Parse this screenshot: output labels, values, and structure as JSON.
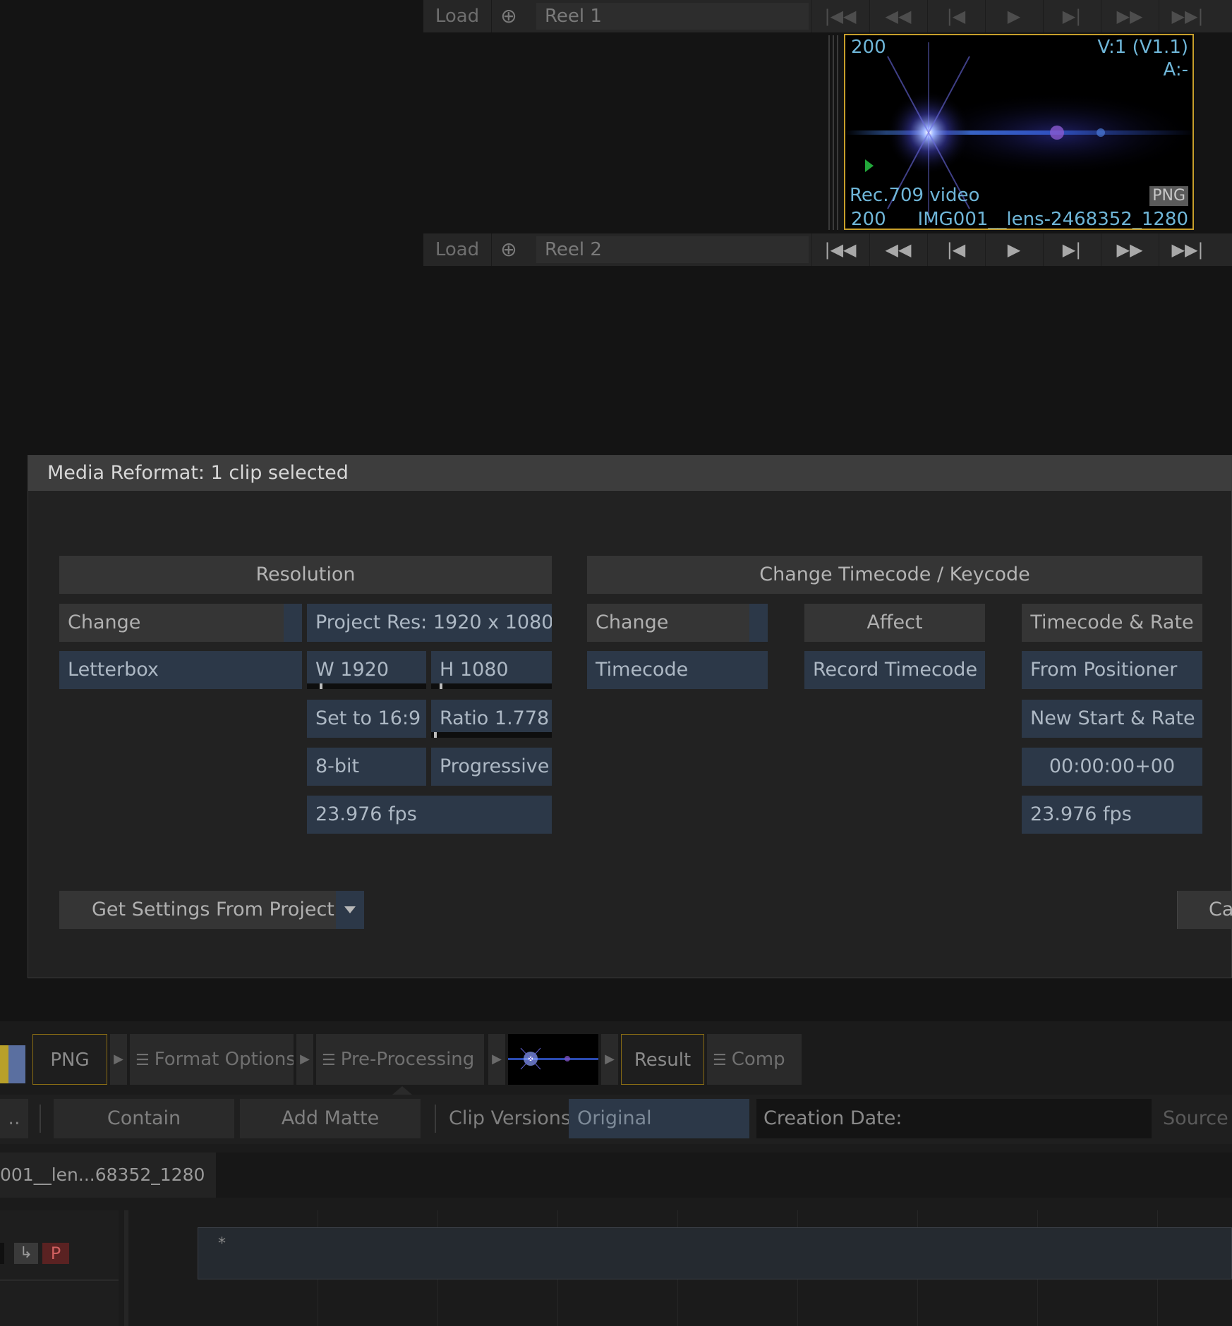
{
  "reel1": {
    "load_label": "Load",
    "name": "Reel 1",
    "transport": [
      "|◀◀",
      "◀◀",
      "|◀",
      "▶",
      "▶|",
      "▶▶",
      "▶▶|"
    ]
  },
  "reel2": {
    "load_label": "Load",
    "name": "Reel 2",
    "transport": [
      "|◀◀",
      "◀◀",
      "|◀",
      "▶",
      "▶|",
      "▶▶",
      "▶▶|"
    ]
  },
  "viewer": {
    "frame_top": "200",
    "version": "V:1 (V1.1)",
    "audio": "A:-",
    "colorspace": "Rec.709 video",
    "format_badge": "PNG",
    "frame_bottom": "200",
    "clip_name": "IMG001__lens-2468352_1280"
  },
  "dialog": {
    "title": "Media Reformat:  1 clip selected",
    "resolution": {
      "header": "Resolution",
      "change": "Change",
      "fit_mode": "Letterbox",
      "project_res": "Project Res:  1920 x 1080",
      "width": "W 1920",
      "height": "H 1080",
      "set_aspect": "Set to 16:9",
      "ratio": "Ratio 1.778",
      "bit_depth": "8-bit",
      "scan": "Progressive",
      "fps": "23.976 fps"
    },
    "timecode": {
      "header": "Change Timecode / Keycode",
      "change": "Change",
      "mode": "Timecode",
      "affect_header": "Affect",
      "affect_value": "Record Timecode",
      "rate_header": "Timecode & Rate",
      "from_positioner": "From Positioner",
      "new_start": "New Start & Rate",
      "start_tc": "00:00:00+00",
      "fps": "23.976 fps"
    },
    "get_settings": "Get Settings From Project",
    "cancel_partial": "Ca"
  },
  "pipeline": {
    "png_label": "PNG",
    "format_options": "Format Options",
    "pre_processing": "Pre-Processing",
    "result": "Result",
    "comp": "Comp"
  },
  "toolbar": {
    "contain": "Contain",
    "add_matte": "Add Matte",
    "clip_versions_label": "Clip Versions",
    "clip_versions_value": "Original",
    "creation_date": "Creation Date:",
    "source_partial": "Source S",
    "left_partial": ".."
  },
  "clip_tab": "001__len...68352_1280",
  "track": {
    "p_label": "P",
    "star": "*"
  }
}
